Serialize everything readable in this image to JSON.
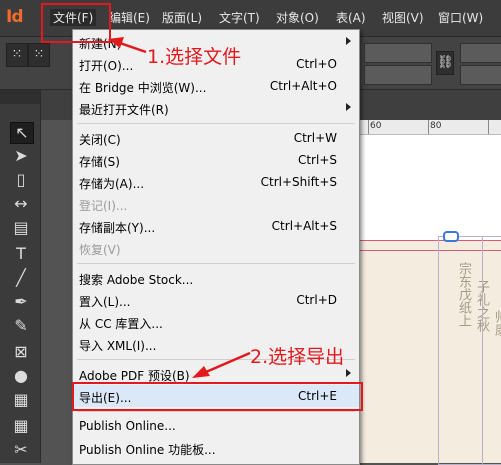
{
  "app": {
    "logo_text": "Id"
  },
  "menubar": {
    "items": [
      {
        "label": "文件(F)"
      },
      {
        "label": "编辑(E)"
      },
      {
        "label": "版面(L)"
      },
      {
        "label": "文字(T)"
      },
      {
        "label": "对象(O)"
      },
      {
        "label": "表(A)"
      },
      {
        "label": "视图(V)"
      },
      {
        "label": "窗口(W)"
      }
    ]
  },
  "ruler": {
    "labels": [
      "60",
      "80"
    ]
  },
  "file_menu": {
    "items": [
      {
        "label": "新建(N)",
        "shortcut": "",
        "submenu": true
      },
      {
        "label": "打开(O)...",
        "shortcut": "Ctrl+O"
      },
      {
        "label": "在 Bridge 中浏览(W)...",
        "shortcut": "Ctrl+Alt+O"
      },
      {
        "label": "最近打开文件(R)",
        "shortcut": "",
        "submenu": true
      },
      {
        "label": "关闭(C)",
        "shortcut": "Ctrl+W"
      },
      {
        "label": "存储(S)",
        "shortcut": "Ctrl+S"
      },
      {
        "label": "存储为(A)...",
        "shortcut": "Ctrl+Shift+S"
      },
      {
        "label": "登记(I)...",
        "shortcut": "",
        "disabled": true
      },
      {
        "label": "存储副本(Y)...",
        "shortcut": "Ctrl+Alt+S"
      },
      {
        "label": "恢复(V)",
        "shortcut": "",
        "disabled": true
      },
      {
        "label": "搜索 Adobe Stock...",
        "shortcut": ""
      },
      {
        "label": "置入(L)...",
        "shortcut": "Ctrl+D"
      },
      {
        "label": "从 CC 库置入...",
        "shortcut": ""
      },
      {
        "label": "导入 XML(I)...",
        "shortcut": ""
      },
      {
        "label": "Adobe PDF 预设(B)",
        "shortcut": "",
        "submenu": true
      },
      {
        "label": "导出(E)...",
        "shortcut": "Ctrl+E",
        "highlighted": true
      },
      {
        "label": "Publish Online...",
        "shortcut": ""
      },
      {
        "label": "Publish Online 功能板...",
        "shortcut": ""
      }
    ]
  },
  "annotations": {
    "step1": "1.选择文件",
    "step2": "2.选择导出"
  },
  "colors": {
    "annotation": "#e3191e",
    "app_accent": "#f26a2d",
    "highlight": "#dbe8f8"
  },
  "tools": [
    "selection-tool",
    "direct-selection-tool",
    "page-tool",
    "gap-tool",
    "content-collector-tool",
    "type-tool",
    "line-tool",
    "pen-tool",
    "pencil-tool",
    "rectangle-frame-tool",
    "ellipse-tool",
    "table-tool",
    "scissors-tool"
  ]
}
